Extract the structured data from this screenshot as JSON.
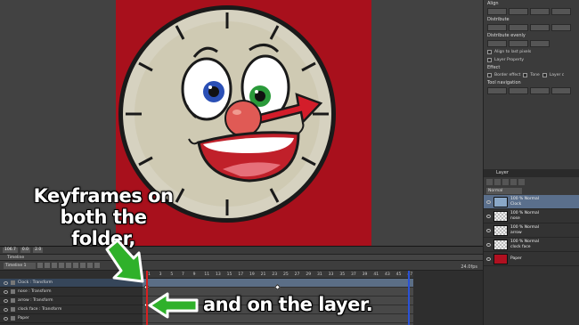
{
  "app": {
    "accent": "#5a6f8c",
    "canvas_bg": "#a8101c"
  },
  "right_panel": {
    "align_title": "Align",
    "distribute_title": "Distribute",
    "distribute_evenly_title": "Distribute evenly",
    "align_pixels_label": "Align to last pixels",
    "layer_property_label": "Layer Property",
    "effect_title": "Effect",
    "border_effect_label": "Border effect",
    "tone_label": "Tone",
    "layer_color_label": "Layer c",
    "tool_navigation_title": "Tool navigation"
  },
  "layer_panel": {
    "tab_label": "Layer",
    "blend_mode": "Normal",
    "layers": [
      {
        "line1": "100 % Normal",
        "line2": "Clock",
        "type": "folder"
      },
      {
        "line1": "100 % Normal",
        "line2": "nose",
        "type": "raster"
      },
      {
        "line1": "100 % Normal",
        "line2": "arrow",
        "type": "raster"
      },
      {
        "line1": "100 % Normal",
        "line2": "clock face",
        "type": "raster"
      },
      {
        "line1": "Paper",
        "line2": "",
        "type": "paper"
      }
    ]
  },
  "timeline": {
    "zoom_value": "106.7",
    "frame_value": "0.0",
    "second_value": "2.0",
    "tab_label": "Timeline",
    "timeline_name": "Timeline 1",
    "fps": "24.0fps",
    "tracks": [
      {
        "label": "Clock : Transform",
        "kind": "folder"
      },
      {
        "label": "nose : Transform",
        "kind": "layer"
      },
      {
        "label": "arrow : Transform",
        "kind": "layer"
      },
      {
        "label": "clock face : Transform",
        "kind": "layer"
      },
      {
        "label": "Paper",
        "kind": "layer"
      }
    ],
    "frames": [
      "1",
      "3",
      "5",
      "7",
      "9",
      "11",
      "13",
      "15",
      "17",
      "19",
      "21",
      "23",
      "25",
      "27",
      "29",
      "31",
      "33",
      "35",
      "37",
      "39",
      "41",
      "43",
      "45",
      "47"
    ]
  },
  "annotations": {
    "caption_top_line1": "Keyframes on",
    "caption_top_line2": "both the folder,",
    "caption_bottom": "and on the layer.",
    "arrow_color": "#2fb12a"
  }
}
